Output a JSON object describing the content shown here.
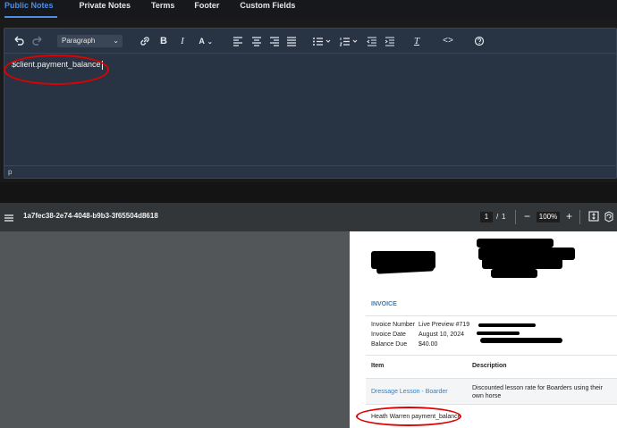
{
  "tabs": [
    "Public Notes",
    "Private Notes",
    "Terms",
    "Footer",
    "Custom Fields"
  ],
  "editor": {
    "block_format": "Paragraph",
    "content": "$client.payment_balance",
    "status_path": "p"
  },
  "pdf": {
    "title": "1a7fec38-2e74-4048-b9b3-3f65504d8618",
    "current_page": "1",
    "page_sep": "/",
    "total_pages": "1",
    "zoom": "100%"
  },
  "invoice": {
    "heading": "INVOICE",
    "fields": [
      {
        "label": "Invoice Number",
        "value": "Live Preview #719"
      },
      {
        "label": "Invoice Date",
        "value": "August 10, 2024"
      },
      {
        "label": "Balance Due",
        "value": "$40.00"
      }
    ],
    "columns": {
      "item": "Item",
      "description": "Description"
    },
    "line_item": {
      "name": "Dressage Lesson - Boarder",
      "description": "Discounted lesson rate for Boarders using their own horse"
    },
    "public_note": "Heath Warren payment_balance"
  },
  "colors": {
    "accent": "#4c8ee6",
    "link": "#2f80c5",
    "annotation": "#e00000"
  }
}
